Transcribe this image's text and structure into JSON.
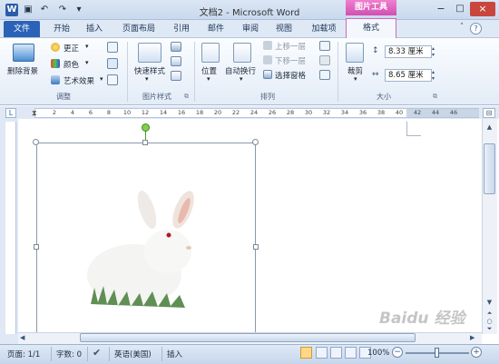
{
  "window": {
    "title": "文档2 - Microsoft Word",
    "context_tab": "图片工具",
    "controls": [
      "−",
      "□",
      "×"
    ]
  },
  "quick_access": {
    "icons": [
      "word-icon",
      "save-icon",
      "undo-icon",
      "redo-icon",
      "customize-qat-icon"
    ]
  },
  "tabs": [
    {
      "label": "文件"
    },
    {
      "label": "开始"
    },
    {
      "label": "插入"
    },
    {
      "label": "页面布局"
    },
    {
      "label": "引用"
    },
    {
      "label": "邮件"
    },
    {
      "label": "审阅"
    },
    {
      "label": "视图"
    },
    {
      "label": "加载项"
    },
    {
      "label": "格式"
    }
  ],
  "ribbon": {
    "adjust": {
      "remove_bg": "删除背景",
      "corrections": "更正",
      "color": "颜色",
      "artistic": "艺术效果",
      "label": "调整"
    },
    "styles": {
      "quick_styles": "快速样式",
      "label": "图片样式"
    },
    "arrange": {
      "position": "位置",
      "wrap": "自动换行",
      "forward": "上移一层",
      "backward": "下移一层",
      "selection_pane": "选择窗格",
      "label": "排列"
    },
    "size": {
      "crop": "裁剪",
      "height": "8.33 厘米",
      "width": "8.65 厘米",
      "label": "大小"
    }
  },
  "ruler": {
    "ticks": [
      "2",
      "4",
      "6",
      "8",
      "10",
      "12",
      "14",
      "16",
      "18",
      "20",
      "22",
      "24",
      "26",
      "28",
      "30",
      "32",
      "34",
      "36",
      "38",
      "40",
      "42",
      "44",
      "46"
    ]
  },
  "statusbar": {
    "page": "页面: 1/1",
    "words": "字数: 0",
    "language": "英语(美国)",
    "mode": "插入",
    "zoom": "100%"
  },
  "watermark": "Baidu 经验",
  "colors": {
    "accent": "#2a62b8",
    "context": "#d24fb2",
    "ribbon_bg": "#eaf1f9"
  }
}
